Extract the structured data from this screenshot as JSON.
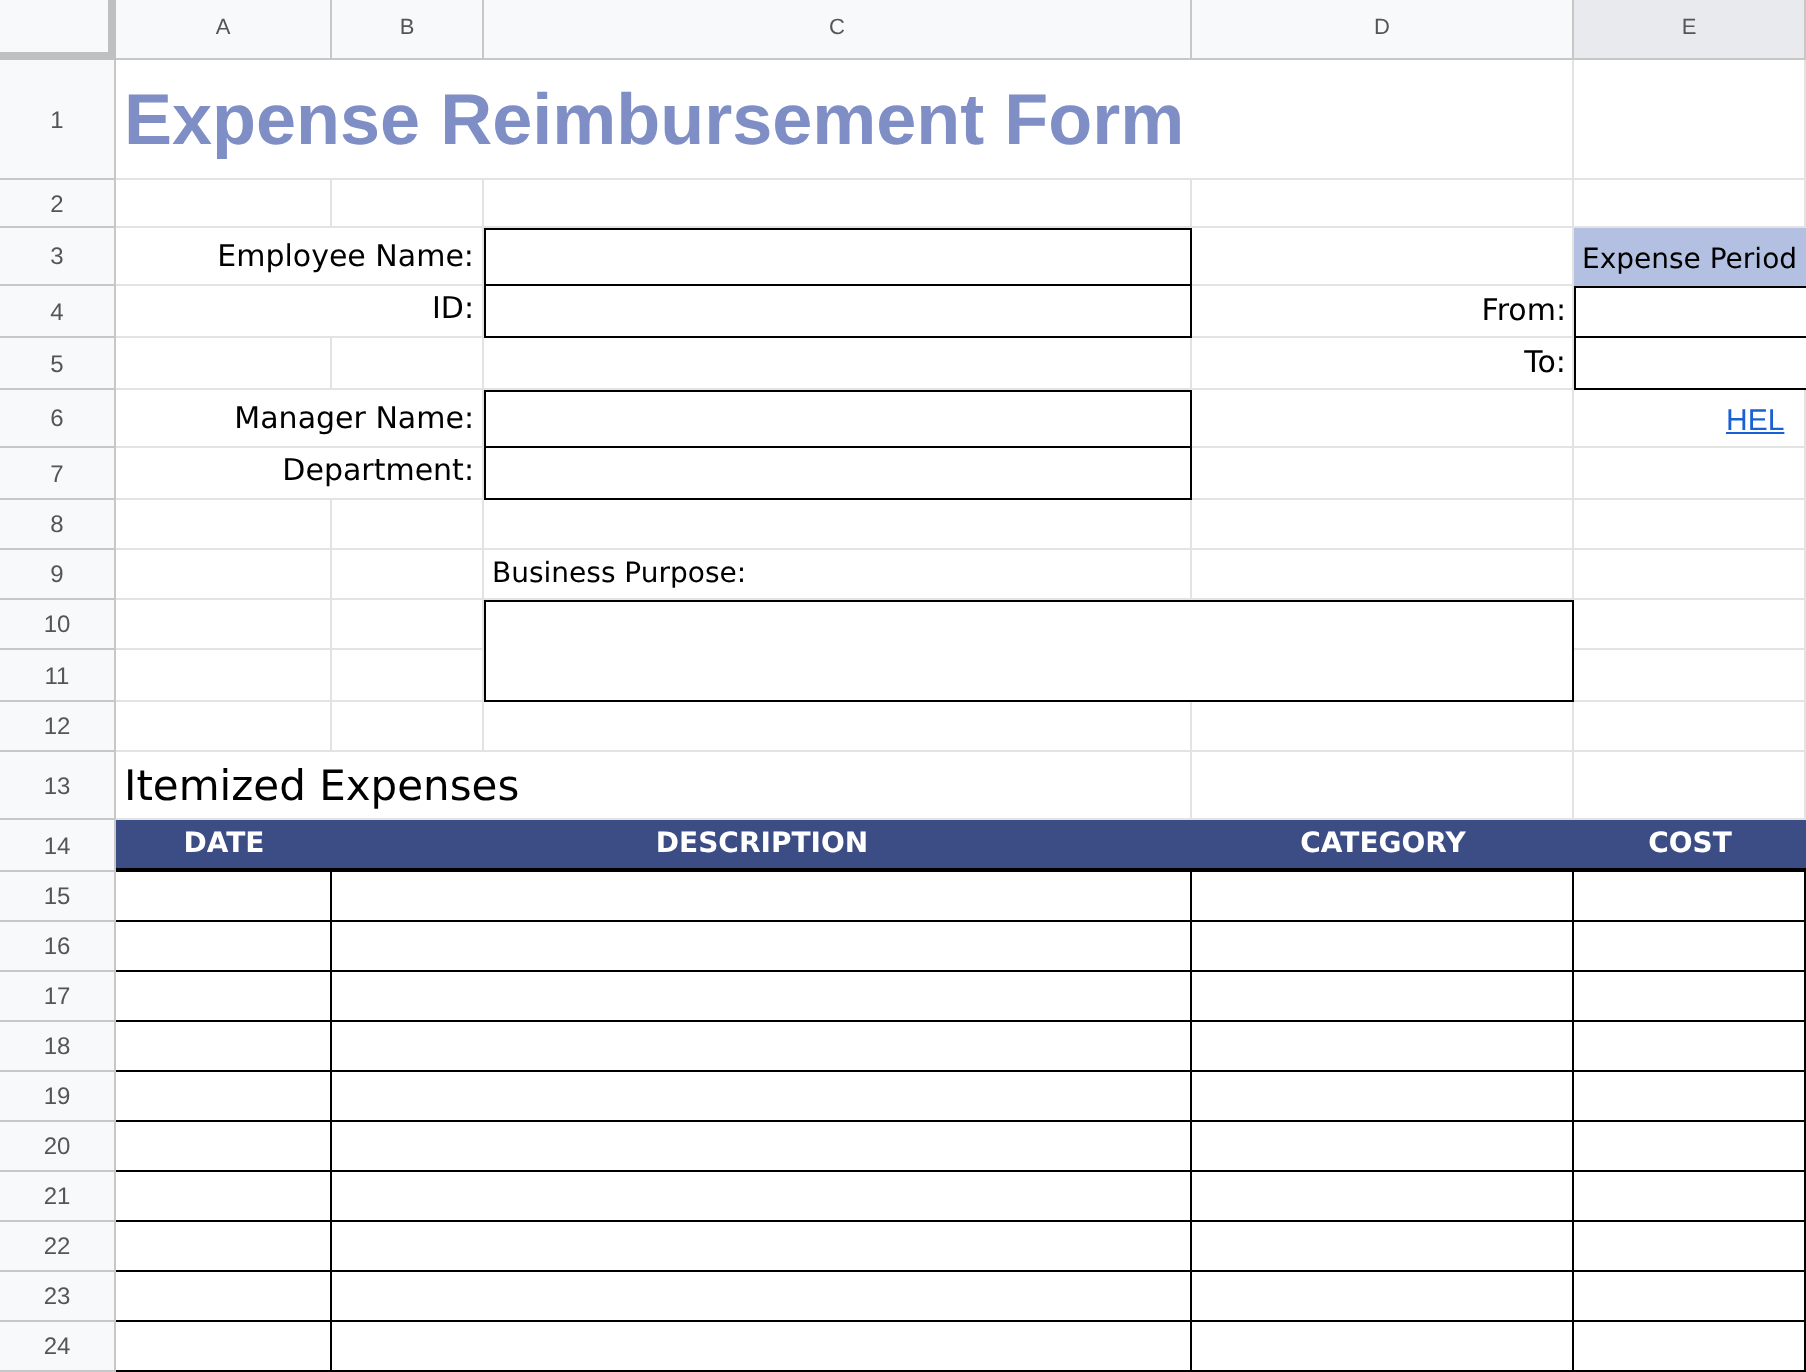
{
  "column_headers": [
    {
      "label": "A",
      "selected": false
    },
    {
      "label": "B",
      "selected": false
    },
    {
      "label": "C",
      "selected": false
    },
    {
      "label": "D",
      "selected": false
    },
    {
      "label": "E",
      "selected": true
    }
  ],
  "row_headers": [
    "1",
    "2",
    "3",
    "4",
    "5",
    "6",
    "7",
    "8",
    "9",
    "10",
    "11",
    "12",
    "13",
    "14",
    "15",
    "16",
    "17",
    "18",
    "19",
    "20",
    "21",
    "22",
    "23",
    "24"
  ],
  "title": "Expense Reimbursement Form",
  "employee_fields": [
    {
      "label": "Employee Name:"
    },
    {
      "label": "ID:"
    }
  ],
  "manager_fields": [
    {
      "label": "Manager Name:"
    },
    {
      "label": "Department:"
    }
  ],
  "business_purpose": {
    "label": "Business Purpose:"
  },
  "expense_period": {
    "title": "Expense Period",
    "fields": [
      {
        "label": "From:"
      },
      {
        "label": "To:"
      }
    ],
    "help_link": "HEL"
  },
  "itemized": {
    "title": "Itemized Expenses",
    "columns": [
      "DATE",
      "DESCRIPTION",
      "CATEGORY",
      "COST"
    ]
  }
}
